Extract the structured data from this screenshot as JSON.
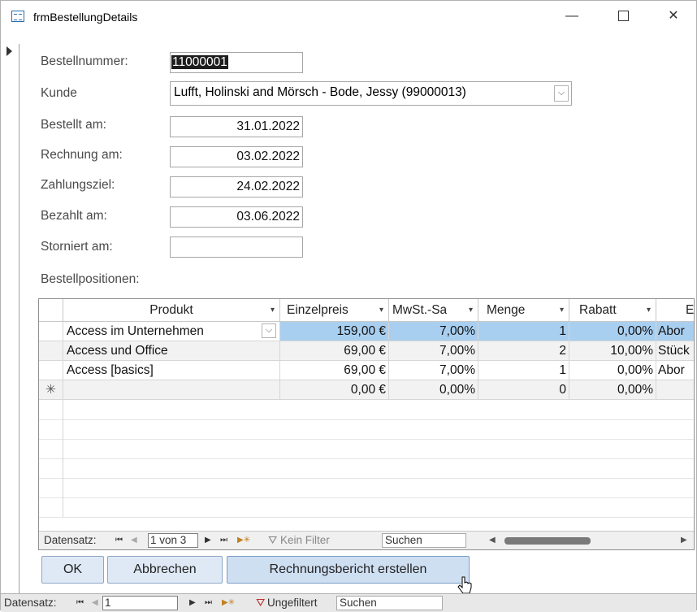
{
  "window": {
    "title": "frmBestellungDetails",
    "min_glyph": "—",
    "close_glyph": "✕"
  },
  "form": {
    "bestellnummer": {
      "label": "Bestellnummer:",
      "value": "11000001"
    },
    "kunde": {
      "label": "Kunde",
      "value": "Lufft, Holinski and Mörsch - Bode, Jessy (99000013)"
    },
    "bestellt_am": {
      "label": "Bestellt am:",
      "value": "31.01.2022"
    },
    "rechnung_am": {
      "label": "Rechnung am:",
      "value": "03.02.2022"
    },
    "zahlungsziel": {
      "label": "Zahlungsziel:",
      "value": "24.02.2022"
    },
    "bezahlt_am": {
      "label": "Bezahlt am:",
      "value": "03.06.2022"
    },
    "storniert_am": {
      "label": "Storniert am:",
      "value": ""
    },
    "positions_label": "Bestellpositionen:"
  },
  "grid": {
    "columns": [
      {
        "label": "Produkt",
        "dropdown": "▾"
      },
      {
        "label": "Einzelpreis",
        "dropdown": "▾"
      },
      {
        "label": "MwSt.-Sa",
        "dropdown": "▾"
      },
      {
        "label": "Menge",
        "dropdown": "▾"
      },
      {
        "label": "Rabatt",
        "dropdown": "▾"
      },
      {
        "label": "E",
        "dropdown": ""
      }
    ],
    "rows": [
      {
        "produkt": "Access im Unternehmen",
        "einzelpreis": "159,00 €",
        "mwst": "7,00%",
        "menge": "1",
        "rabatt": "0,00%",
        "extra": "Abor"
      },
      {
        "produkt": "Access und Office",
        "einzelpreis": "69,00 €",
        "mwst": "7,00%",
        "menge": "2",
        "rabatt": "10,00%",
        "extra": "Stück"
      },
      {
        "produkt": "Access [basics]",
        "einzelpreis": "69,00 €",
        "mwst": "7,00%",
        "menge": "1",
        "rabatt": "0,00%",
        "extra": "Abor"
      }
    ],
    "new_row": {
      "marker": "✳",
      "einzelpreis": "0,00 €",
      "mwst": "0,00%",
      "menge": "0",
      "rabatt": "0,00%"
    },
    "combo_glyph": "⌵"
  },
  "subnav": {
    "label": "Datensatz:",
    "first": "⏮",
    "prev": "◀",
    "position": "1 von 3",
    "next": "▶",
    "last": "⏭",
    "new": "▶✳",
    "filter": "Kein Filter",
    "search": "Suchen"
  },
  "buttons": {
    "ok": "OK",
    "cancel": "Abbrechen",
    "report": "Rechnungsbericht erstellen"
  },
  "mainnav": {
    "label": "Datensatz:",
    "first": "⏮",
    "prev": "◀",
    "position": "1",
    "next": "▶",
    "last": "⏭",
    "new": "▶✳",
    "filter": "Ungefiltert",
    "search": "Suchen"
  }
}
